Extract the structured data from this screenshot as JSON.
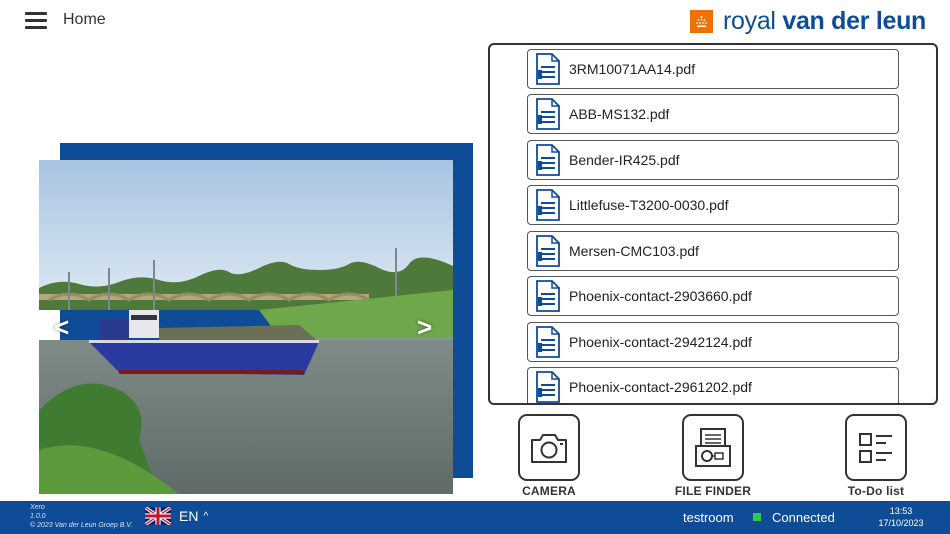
{
  "header": {
    "title": "Home",
    "logo": {
      "text_light": "royal ",
      "text_bold": "van der leun",
      "mark_color": "#ee7203",
      "text_color": "#0e4c97"
    }
  },
  "carousel": {
    "prev_label": "<",
    "next_label": ">",
    "backdrop_color": "#0e4c97"
  },
  "files": [
    {
      "name": "3RM10071AA14.pdf"
    },
    {
      "name": "ABB-MS132.pdf"
    },
    {
      "name": "Bender-IR425.pdf"
    },
    {
      "name": "Littlefuse-T3200-0030.pdf"
    },
    {
      "name": "Mersen-CMC103.pdf"
    },
    {
      "name": "Phoenix-contact-2903660.pdf"
    },
    {
      "name": "Phoenix-contact-2942124.pdf"
    },
    {
      "name": "Phoenix-contact-2961202.pdf"
    }
  ],
  "actions": {
    "camera": {
      "label": "CAMERA",
      "icon": "camera-icon"
    },
    "file_finder": {
      "label": "FILE FINDER",
      "icon": "file-finder-icon"
    },
    "todo": {
      "label": "To-Do list",
      "icon": "checklist-icon"
    }
  },
  "footer": {
    "app_name": "Xero",
    "version": "1.0.0",
    "copyright": "© 2023 Van der Leun Groep B.V.",
    "language": "EN",
    "language_icon": "uk-flag-icon",
    "environment": "testroom",
    "status": "Connected",
    "status_color": "#2ecc40",
    "time": "13:53",
    "date": "17/10/2023",
    "background": "#0e4c97"
  }
}
